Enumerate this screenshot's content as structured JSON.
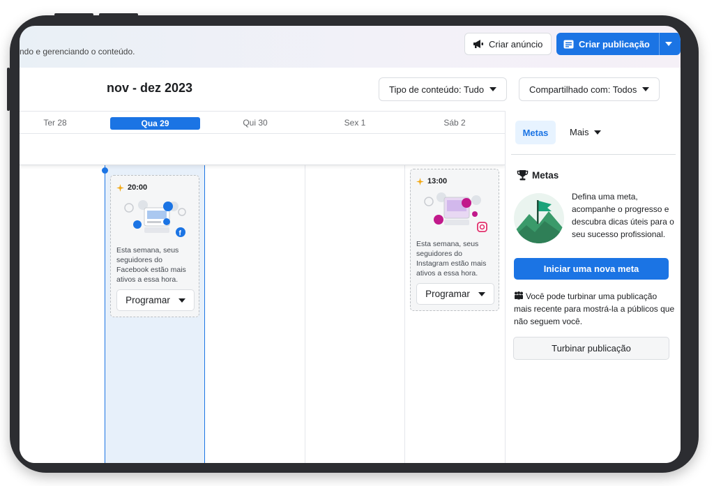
{
  "header": {
    "subtitle": "ndo e gerenciando o conteúdo.",
    "create_ad_label": "Criar anúncio",
    "create_post_label": "Criar publicação"
  },
  "calendar": {
    "date_range": "nov - dez 2023",
    "filters": {
      "content_type": "Tipo de conteúdo: Tudo",
      "shared_with": "Compartilhado com: Todos"
    },
    "days": [
      "Ter 28",
      "Qua 29",
      "Qui 30",
      "Sex 1",
      "Sáb 2"
    ],
    "active_day": "Qua 29",
    "slots": [
      {
        "day": "Qua 29",
        "time": "20:00",
        "network": "Facebook",
        "text": "Esta semana, seus seguidores do Facebook estão mais ativos a essa hora.",
        "button_label": "Programar"
      },
      {
        "day": "Sáb 2",
        "time": "13:00",
        "network": "Instagram",
        "text": "Esta semana, seus seguidores do Instagram estão mais ativos a essa hora.",
        "button_label": "Programar"
      }
    ]
  },
  "sidebar": {
    "tabs": [
      {
        "label": "Metas",
        "active": true
      },
      {
        "label": "Mais",
        "active": false
      }
    ],
    "goals": {
      "title": "Metas",
      "description": "Defina uma meta, acompanhe o progresso e descubra dicas úteis para o seu sucesso profissional.",
      "start_button": "Iniciar uma nova meta"
    },
    "boost": {
      "text": "Você pode turbinar uma publicação mais recente para mostrá-la a públicos que não seguem você.",
      "button": "Turbinar publicação"
    }
  },
  "colors": {
    "accent": "#1b74e4",
    "today_column": "#e7f0fa",
    "device_frame": "#2c2d31"
  },
  "icons": [
    "megaphone-icon",
    "post-icon",
    "chevron-down-icon",
    "sparkle-icon",
    "facebook-icon",
    "instagram-icon",
    "trophy-icon",
    "people-icon",
    "flag-mountain-illustration"
  ]
}
